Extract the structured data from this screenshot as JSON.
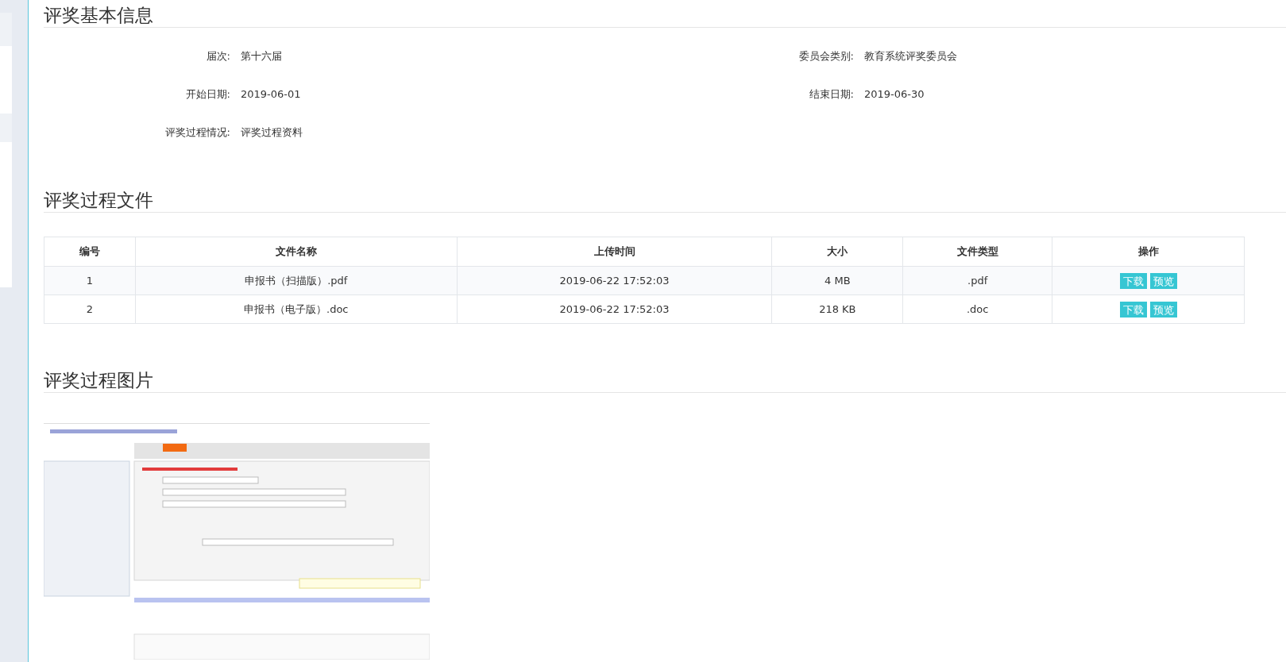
{
  "sections": [
    {
      "title": "评奖基本信息"
    },
    {
      "title": "评奖过程文件"
    },
    {
      "title": "评奖过程图片"
    }
  ],
  "info": [
    {
      "label": "届次:",
      "value": "第十六届"
    },
    {
      "label": "委员会类别:",
      "value": "教育系统评奖委员会"
    },
    {
      "label": "开始日期:",
      "value": "2019-06-01"
    },
    {
      "label": "结束日期:",
      "value": "2019-06-30"
    },
    {
      "label": "评奖过程情况:",
      "value": "评奖过程资料"
    }
  ],
  "table": {
    "columns": [
      "编号",
      "文件名称",
      "上传时间",
      "大小",
      "文件类型",
      "操作"
    ],
    "rows": [
      {
        "cells": [
          "1",
          "申报书（扫描版）.pdf",
          "2019-06-22 17:52:03",
          "4 MB",
          ".pdf"
        ],
        "actions": [
          "下载",
          "预览"
        ]
      },
      {
        "cells": [
          "2",
          "申报书（电子版）.doc",
          "2019-06-22 17:52:03",
          "218 KB",
          ".doc"
        ],
        "actions": [
          "下载",
          "预览"
        ]
      }
    ]
  }
}
